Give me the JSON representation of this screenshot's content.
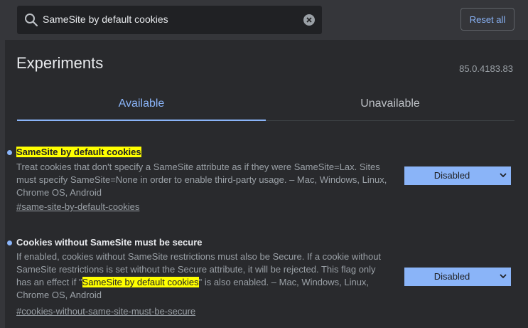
{
  "search": {
    "query": "SameSite by default cookies",
    "icon": "search-icon"
  },
  "toolbar": {
    "reset_label": "Reset all"
  },
  "page": {
    "title": "Experiments",
    "version": "85.0.4183.83"
  },
  "tabs": [
    {
      "label": "Available",
      "active": true
    },
    {
      "label": "Unavailable",
      "active": false
    }
  ],
  "experiments": [
    {
      "title": "SameSite by default cookies",
      "description": "Treat cookies that don't specify a SameSite attribute as if they were SameSite=Lax. Sites must specify SameSite=None in order to enable third-party usage. – Mac, Windows, Linux, Chrome OS, Android",
      "link": "#same-site-by-default-cookies",
      "value": "Disabled"
    },
    {
      "title": "Cookies without SameSite must be secure",
      "description_before": "If enabled, cookies without SameSite restrictions must also be Secure. If a cookie without SameSite restrictions is set without the Secure attribute, it will be rejected. This flag only has an effect if \"",
      "description_highlight": "SameSite by default cookies",
      "description_after": "\" is also enabled. – Mac, Windows, Linux, Chrome OS, Android",
      "link": "#cookies-without-same-site-must-be-secure",
      "value": "Disabled"
    }
  ],
  "colors": {
    "accent": "#8ab4f8",
    "highlight": "#ffff00",
    "background": "#292a2d"
  }
}
